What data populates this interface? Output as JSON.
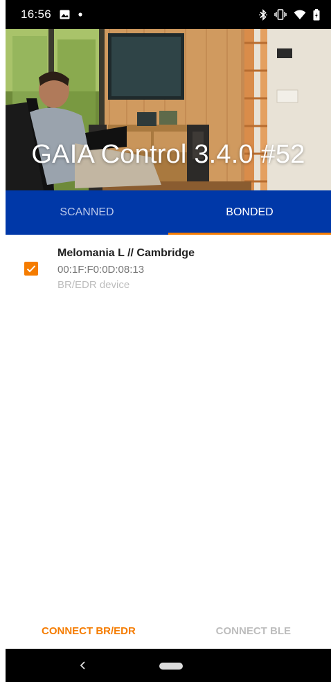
{
  "status_bar": {
    "time": "16:56",
    "icons": [
      "image-icon",
      "dot-icon",
      "bluetooth-icon",
      "vibrate-icon",
      "wifi-icon",
      "battery-icon"
    ]
  },
  "header": {
    "title": "GAIA Control 3.4.0 #52"
  },
  "tabs": [
    {
      "label": "SCANNED",
      "active": false
    },
    {
      "label": "BONDED",
      "active": true
    }
  ],
  "devices": [
    {
      "name": "Melomania L // Cambridge",
      "address": "00:1F:F0:0D:08:13",
      "type": "BR/EDR device",
      "checked": true
    }
  ],
  "actions": {
    "connect_brdr": "CONNECT BR/EDR",
    "connect_ble": "CONNECT BLE"
  },
  "colors": {
    "accent": "#f57c00",
    "tab_bar": "#0038a8",
    "disabled": "#bdbdbd"
  },
  "nav_bar": {
    "icons": [
      "back-icon",
      "home-pill-icon"
    ]
  }
}
